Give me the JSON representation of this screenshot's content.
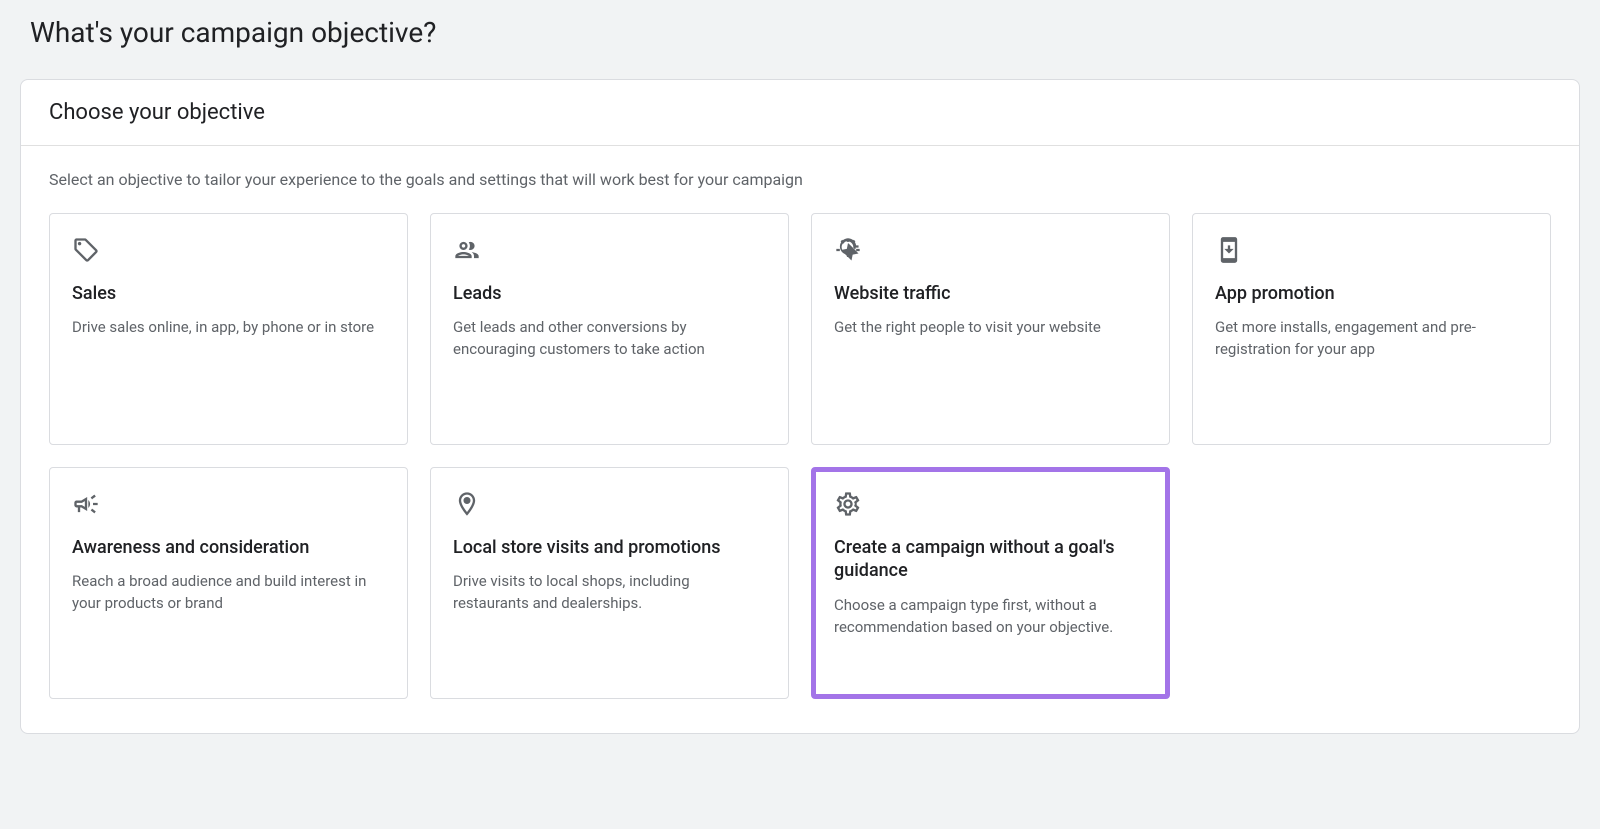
{
  "pageTitle": "What's your campaign objective?",
  "cardHeader": "Choose your objective",
  "subtitle": "Select an objective to tailor your experience to the goals and settings that will work best for your campaign",
  "objectives": [
    {
      "id": "sales",
      "icon": "tag",
      "title": "Sales",
      "description": "Drive sales online, in app, by phone or in store",
      "highlighted": false
    },
    {
      "id": "leads",
      "icon": "people",
      "title": "Leads",
      "description": "Get leads and other conversions by encouraging customers to take action",
      "highlighted": false
    },
    {
      "id": "website-traffic",
      "icon": "click",
      "title": "Website traffic",
      "description": "Get the right people to visit your website",
      "highlighted": false
    },
    {
      "id": "app-promotion",
      "icon": "phone",
      "title": "App promotion",
      "description": "Get more installs, engagement and pre-registration for your app",
      "highlighted": false
    },
    {
      "id": "awareness",
      "icon": "megaphone",
      "title": "Awareness and consideration",
      "description": "Reach a broad audience and build interest in your products or brand",
      "highlighted": false
    },
    {
      "id": "local-store",
      "icon": "location",
      "title": "Local store visits and promotions",
      "description": "Drive visits to local shops, including restaurants and dealerships.",
      "highlighted": false
    },
    {
      "id": "no-goal",
      "icon": "gear",
      "title": "Create a campaign without a goal's guidance",
      "description": "Choose a campaign type first, without a recommendation based on your objective.",
      "highlighted": true
    }
  ]
}
